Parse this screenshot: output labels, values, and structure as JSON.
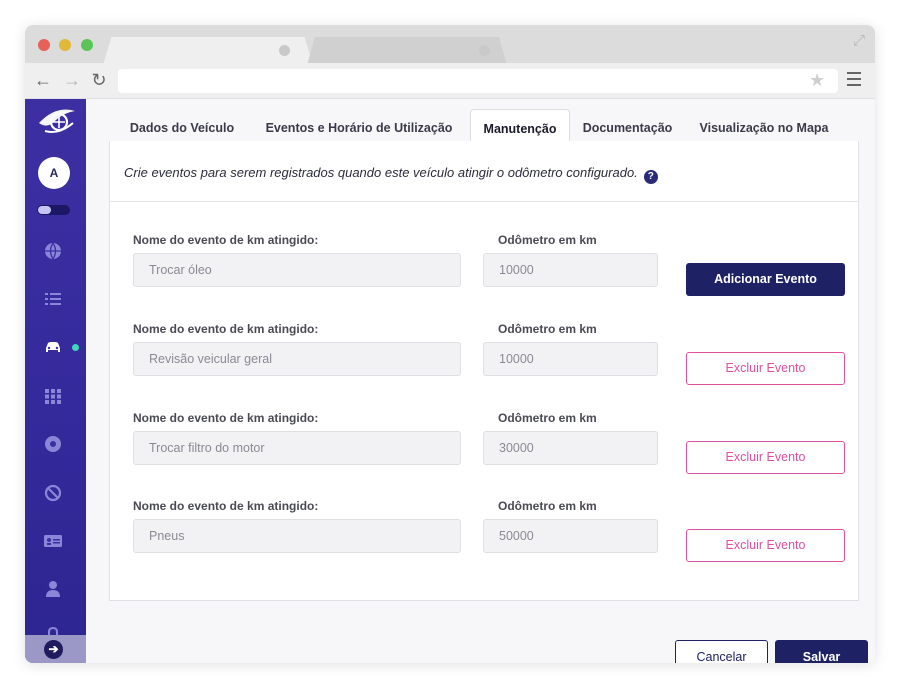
{
  "browser": {
    "icons": {
      "back": "arrow-left-icon",
      "forward": "arrow-right-icon",
      "reload": "reload-icon",
      "bookmark": "star-icon",
      "menu": "hamburger-menu-icon",
      "expand": "expand-icon"
    },
    "back_glyph": "←",
    "forward_glyph": "→",
    "reload_glyph": "↻",
    "star_glyph": "★",
    "expand_glyph": "⤢"
  },
  "sidebar": {
    "avatar_initial": "A",
    "icons": [
      "globe-icon",
      "list-icon",
      "car-icon",
      "grid-icon",
      "record-icon",
      "block-icon",
      "id-card-icon",
      "user-icon",
      "lock-icon"
    ],
    "active_item": "car-icon",
    "arrow_glyph": "➔",
    "colors": {
      "background": "#3c2fa2",
      "active_indicator": "#3ed8b7"
    }
  },
  "tabs": [
    {
      "label": "Dados do Veículo"
    },
    {
      "label": "Eventos e Horário de Utilização"
    },
    {
      "label": "Manutenção"
    },
    {
      "label": "Documentação"
    },
    {
      "label": "Visualização no Mapa"
    }
  ],
  "active_tab": "Manutenção",
  "panel": {
    "intro": "Crie eventos para serem registrados quando este veículo atingir o odômetro configurado.",
    "help_glyph": "?",
    "name_label": "Nome do evento de km atingido:",
    "odometer_label": "Odômetro em km",
    "events": [
      {
        "name": "Trocar óleo",
        "odometer": "10000",
        "action": "Adicionar Evento"
      },
      {
        "name": "Revisão veicular geral",
        "odometer": "10000",
        "action": "Excluir Evento"
      },
      {
        "name": "Trocar filtro do motor",
        "odometer": "30000",
        "action": "Excluir Evento"
      },
      {
        "name": "Pneus",
        "odometer": "50000",
        "action": "Excluir Evento"
      }
    ]
  },
  "footer": {
    "cancel_label": "Cancelar",
    "save_label": "Salvar"
  },
  "colors": {
    "primary": "#1e2163",
    "danger": "#e24fa0"
  }
}
